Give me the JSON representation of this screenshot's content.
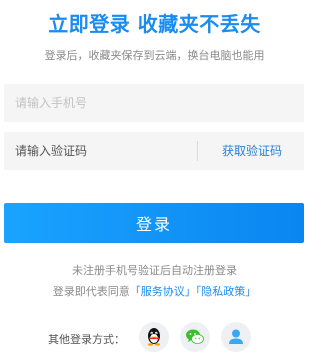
{
  "header": {
    "title": "立即登录 收藏夹不丢失",
    "subtitle": "登录后，收藏夹保存到云端，换台电脑也能用"
  },
  "form": {
    "phone_placeholder": "请输入手机号",
    "code_placeholder": "请输入验证码",
    "get_code_label": "获取验证码",
    "login_label": "登录"
  },
  "notice": {
    "line1": "未注册手机号验证后自动注册登录",
    "line2_prefix": "登录即代表同意",
    "service_link": "「服务协议」",
    "privacy_link": "「隐私政策」"
  },
  "other_login": {
    "label": "其他登录方式：",
    "providers": [
      "qq-icon",
      "wechat-icon",
      "account-icon"
    ]
  },
  "colors": {
    "accent": "#1a8cf0",
    "button_gradient_start": "#1aa3ff",
    "button_gradient_end": "#0a86f0",
    "field_bg": "#f5f5f5",
    "muted_text": "#8a8a8a"
  }
}
